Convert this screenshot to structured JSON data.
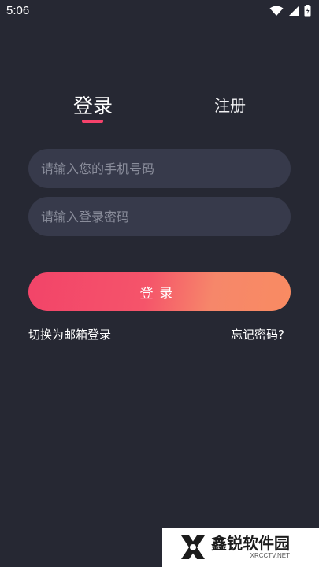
{
  "status_bar": {
    "time": "5:06",
    "icons": [
      "wifi-icon",
      "signal-icon",
      "battery-icon"
    ]
  },
  "tabs": {
    "login": "登录",
    "register": "注册",
    "active": "login"
  },
  "form": {
    "phone_placeholder": "请输入您的手机号码",
    "phone_value": "",
    "password_placeholder": "请输入登录密码",
    "password_value": ""
  },
  "login_button": {
    "label": "登录"
  },
  "links": {
    "switch_email": "切换为邮箱登录",
    "forgot_password": "忘记密码?"
  },
  "watermark": {
    "brand_cn": "鑫锐软件园",
    "brand_en": "XRCCTV.NET"
  },
  "colors": {
    "background": "#262833",
    "input_bg": "#373a4b",
    "accent": "#f5426b",
    "button_gradient_start": "#f24469",
    "button_gradient_end": "#f98b62"
  }
}
